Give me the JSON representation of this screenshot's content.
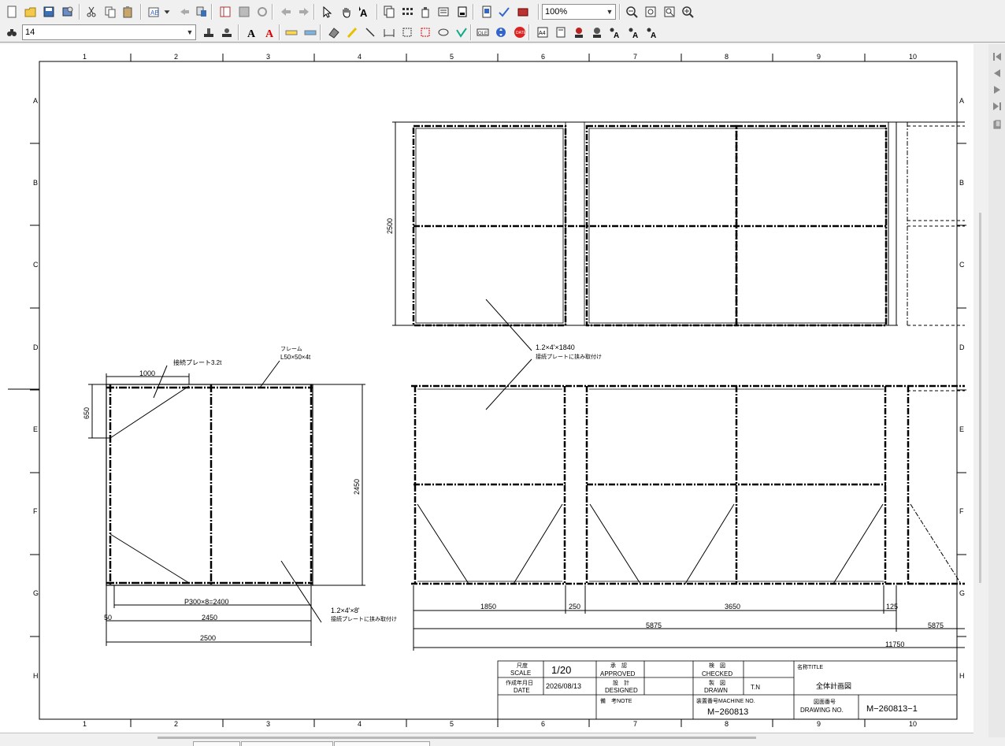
{
  "toolbar1": {
    "zoom_value": "100%"
  },
  "toolbar2": {
    "font_size_value": "14"
  },
  "drawing": {
    "col_labels": [
      "1",
      "2",
      "3",
      "4",
      "5",
      "6",
      "7",
      "8",
      "9",
      "10"
    ],
    "row_labels": [
      "A",
      "B",
      "C",
      "D",
      "E",
      "F",
      "G",
      "H"
    ],
    "left_view": {
      "frame_label1": "フレーム",
      "frame_label2": "L50×50×4t",
      "plate_label": "接続プレート3.2t",
      "dim_1000": "1000",
      "dim_650": "650",
      "dim_2450_v": "2450",
      "dim_p300": "P300×8=2400",
      "dim_50": "50",
      "dim_2450_h": "2450",
      "dim_2500": "2500",
      "panel_note1": "1.2×4'×8'",
      "panel_note2": "接続プレートに挟み取付け"
    },
    "right_view": {
      "dim_2500_v": "2500",
      "panel_note1": "1.2×4'×1840",
      "panel_note2": "接続プレートに挟み取付け",
      "dim_1850": "1850",
      "dim_250": "250",
      "dim_3650": "3650",
      "dim_125": "125",
      "dim_5875_a": "5875",
      "dim_5875_b": "5875",
      "dim_11750": "11750"
    },
    "title_block": {
      "scale_label_jp": "尺度",
      "scale_label_en": "SCALE",
      "scale_value": "1/20",
      "date_label_jp": "作成年月日",
      "date_label_en": "DATE",
      "date_value": "2026/08/13",
      "approved_jp": "承　認",
      "approved_en": "APPROVED",
      "designed_jp": "設　計",
      "designed_en": "DESIGNED",
      "checked_jp": "検　図",
      "checked_en": "CHECKED",
      "drawn_jp": "製　図",
      "drawn_en": "DRAWN",
      "drawn_value": "T.N",
      "note_label": "備　考NOTE",
      "machine_label": "装置番号MACHINE NO.",
      "machine_value": "M−260813",
      "title_label": "名称TITLE",
      "title_value": "全体計画図",
      "drawing_no_jp": "図面番号",
      "drawing_no_en": "DRAWING NO.",
      "drawing_no_value": "M−260813−1"
    }
  },
  "icons": {
    "toolbar1": [
      "new-file-icon",
      "open-folder-icon",
      "save-icon",
      "save-all-icon",
      "cut-icon",
      "copy-icon",
      "paste-icon",
      "insert-object-icon",
      "dropdown-arrow-icon",
      "undo-icon",
      "paste-special-icon",
      "sheet-icon",
      "layer-icon",
      "refresh-icon",
      "back-arrow-icon",
      "forward-arrow-icon",
      "select-pointer-icon",
      "hand-pan-icon",
      "select-text-icon",
      "copy-page-icon",
      "grid-icon",
      "bottle-icon",
      "properties-icon",
      "page-icon",
      "document-icon",
      "check-icon",
      "book-icon",
      "zoom-out-icon",
      "zoom-window-icon",
      "zoom-prev-icon",
      "zoom-in-icon"
    ],
    "toolbar2": [
      "binoculars-icon",
      "font-size-dropdown-icon",
      "stamp-a-icon",
      "stamp-b-icon",
      "text-bold-a-icon",
      "text-red-a-icon",
      "yellow-highlight-icon",
      "blue-highlight-icon",
      "eraser-icon",
      "pen-icon",
      "line-icon",
      "dimension-h-icon",
      "dimension-box-icon",
      "dimension-red-icon",
      "cloud-icon",
      "check-mark-icon",
      "date-stamp-icon",
      "move-icon",
      "date-circle-icon",
      "a4-icon",
      "ruler-icon",
      "stamp-red-icon",
      "stamp-dark-icon",
      "font-a1-icon",
      "font-a2-icon",
      "font-a3-icon"
    ],
    "nav": [
      "first-page-icon",
      "prev-page-icon",
      "next-page-icon",
      "last-page-icon",
      "page-list-icon"
    ]
  }
}
